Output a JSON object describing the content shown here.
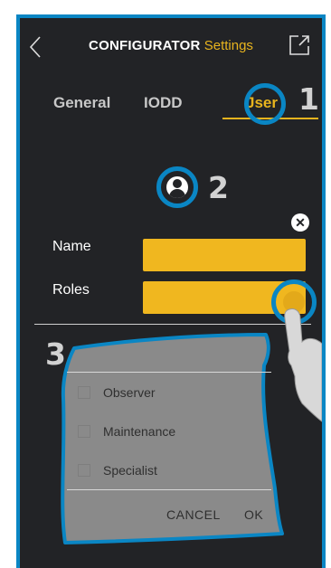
{
  "header": {
    "title_brand": "CONFIGURATOR",
    "title_sub": "Settings"
  },
  "tabs": [
    {
      "label": "General"
    },
    {
      "label": "IODD"
    },
    {
      "label": "User",
      "shown": "Jser",
      "active": true
    }
  ],
  "callouts": {
    "step1": "1",
    "step2": "2",
    "step3": "3"
  },
  "form": {
    "name_label": "Name",
    "roles_label": "Roles"
  },
  "roles_dropdown": {
    "options": [
      {
        "label": "Observer",
        "checked": false
      },
      {
        "label": "Maintenance",
        "checked": false
      },
      {
        "label": "Specialist",
        "checked": false
      }
    ],
    "cancel_label": "CANCEL",
    "ok_label": "OK"
  },
  "icons": [
    "back-chevron-icon",
    "export-icon",
    "avatar-icon",
    "close-icon",
    "hand-pointer-icon"
  ],
  "colors": {
    "background": "#222326",
    "accent": "#e8b41e",
    "field": "#f0b71f",
    "callout_blue": "#0a86c4",
    "panel": "#8a8a8a"
  }
}
